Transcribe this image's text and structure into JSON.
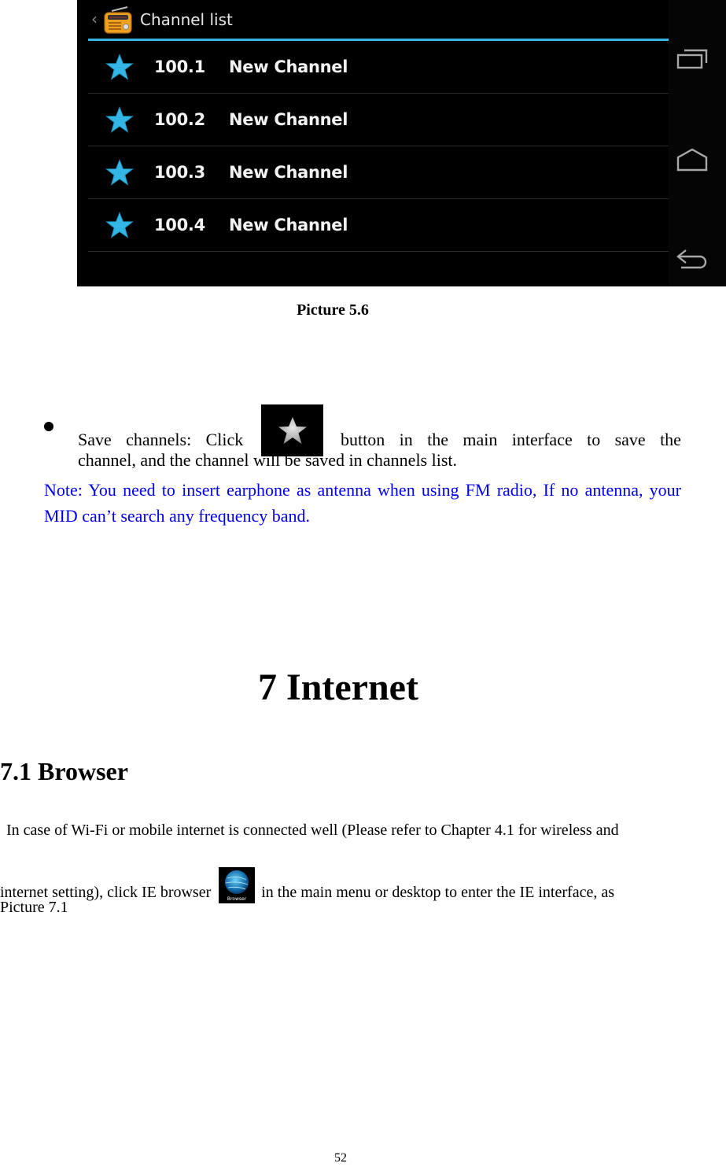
{
  "screenshot": {
    "title": "Channel list",
    "app_icon": "radio-icon",
    "back_icon": "chevron-left-icon",
    "accent_color": "#33b5e5",
    "star_color": "#33b5e5",
    "channels": [
      {
        "frequency": "100.1",
        "name": "New Channel",
        "icon": "star-icon"
      },
      {
        "frequency": "100.2",
        "name": "New Channel",
        "icon": "star-icon"
      },
      {
        "frequency": "100.3",
        "name": "New Channel",
        "icon": "star-icon"
      },
      {
        "frequency": "100.4",
        "name": "New Channel",
        "icon": "star-icon"
      }
    ],
    "navbar": [
      "recent-apps-icon",
      "home-icon",
      "back-icon"
    ]
  },
  "caption": "Picture 5.6",
  "bullet": {
    "part1a": "Save",
    "part1b": "channels:",
    "part1c": "Click",
    "icon": "star-icon",
    "part2": [
      "button",
      "in",
      "the",
      "main",
      "interface",
      "to",
      "save",
      "the"
    ],
    "line2": "channel, and the channel will be saved in channels list."
  },
  "note": {
    "text": "Note: You need to insert earphone as antenna when using FM radio, If no antenna, your MID can’t search any frequency band.",
    "color": "#0000ee"
  },
  "chapter_title": "7 Internet",
  "section_title": "7.1 Browser",
  "paragraph": {
    "line1": "In case of Wi-Fi or mobile internet is connected well (Please refer to Chapter 4.1 for wireless and",
    "line2_before": "internet setting), click IE browser",
    "icon_label": "Browser",
    "line2_after": "in the main menu or desktop to enter the IE interface, as",
    "line3": "Picture 7.1"
  },
  "page_number": "52"
}
